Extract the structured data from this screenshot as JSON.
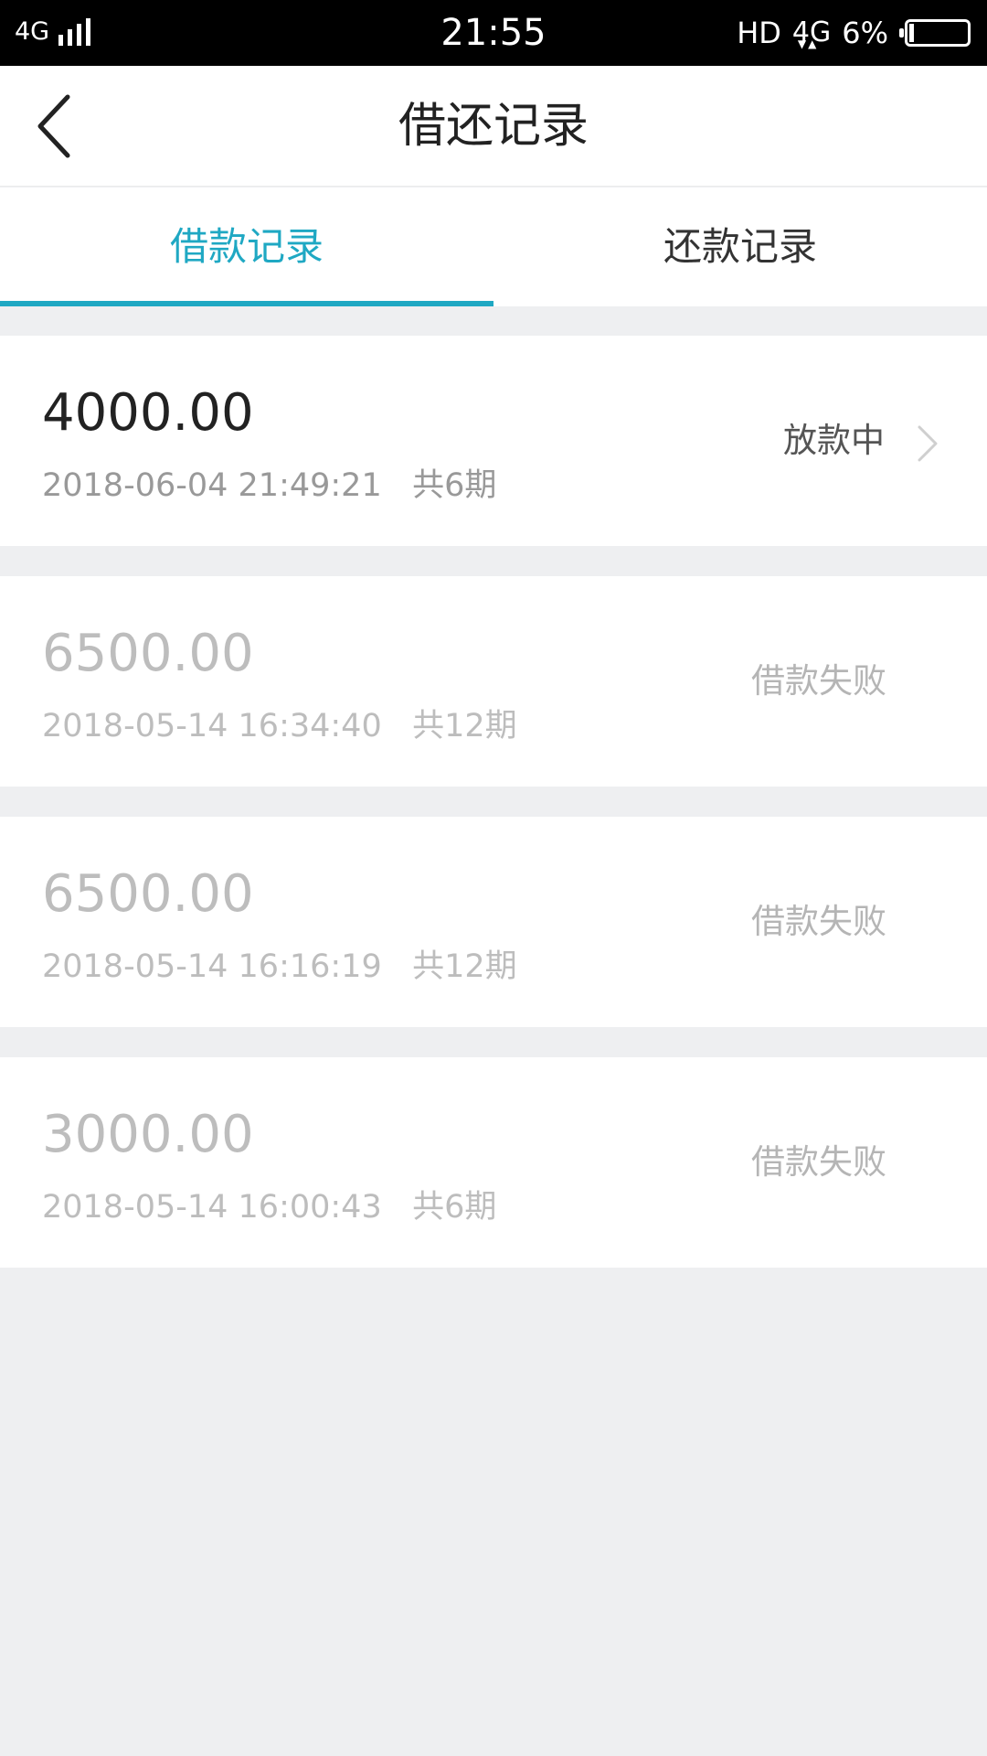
{
  "status_bar": {
    "network": "4G",
    "time": "21:55",
    "hd": "HD",
    "data_type": "4G",
    "battery_percent": "6%"
  },
  "nav": {
    "title": "借还记录",
    "back_icon": "chevron-left-icon"
  },
  "tabs": [
    {
      "label": "借款记录",
      "active": true
    },
    {
      "label": "还款记录",
      "active": false
    }
  ],
  "colors": {
    "accent": "#1fa8c3",
    "background": "#eeeff1",
    "failed_text": "#bdbdbd"
  },
  "records": [
    {
      "amount": "4000.00",
      "datetime": "2018-06-04 21:49:21",
      "periods": "共6期",
      "status": "放款中"
    },
    {
      "amount": "6500.00",
      "datetime": "2018-05-14 16:34:40",
      "periods": "共12期",
      "status": "借款失败"
    },
    {
      "amount": "6500.00",
      "datetime": "2018-05-14 16:16:19",
      "periods": "共12期",
      "status": "借款失败"
    },
    {
      "amount": "3000.00",
      "datetime": "2018-05-14 16:00:43",
      "periods": "共6期",
      "status": "借款失败"
    }
  ]
}
